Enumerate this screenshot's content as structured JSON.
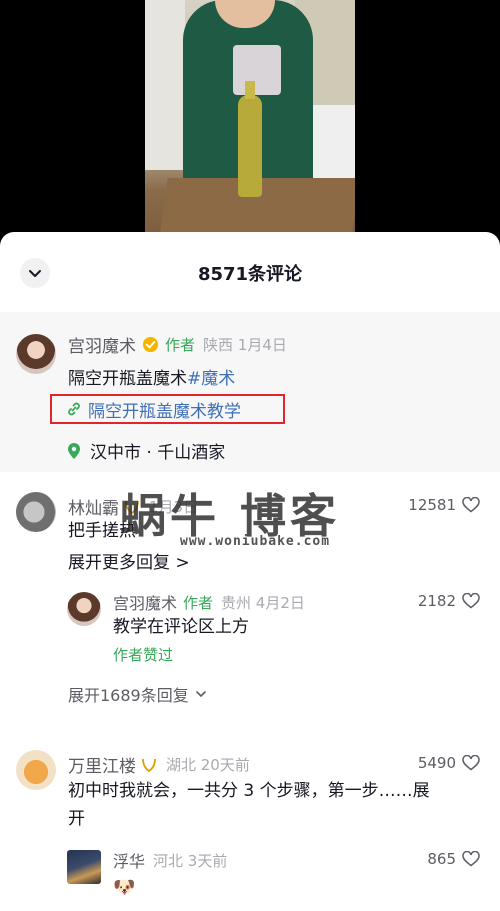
{
  "sheet": {
    "comment_count_title": "8571条评论"
  },
  "pinned_post": {
    "author_name": "宫羽魔术",
    "author_tag": "作者",
    "meta": "陕西 1月4日",
    "text": "隔空开瓶盖魔术",
    "hashtag": "#魔术",
    "link_text": "隔空开瓶盖魔术教学",
    "location": "汉中市 · 千山酒家"
  },
  "comments": [
    {
      "name": "林灿霸",
      "meta": "1月3日",
      "likes": "12581",
      "text": "把手搓热",
      "expand_more": "展开更多回复 >",
      "reply": {
        "name": "宫羽魔术",
        "tag": "作者",
        "meta": "贵州 4月2日",
        "likes": "2182",
        "text": "教学在评论区上方",
        "liked_note": "作者赞过"
      },
      "expand_replies": "展开1689条回复"
    },
    {
      "name": "万里江楼",
      "meta": "湖北 20天前",
      "likes": "5490",
      "text_line1": "初中时我就会，一共分 3 个步骤，第一步……展",
      "text_line2": "开",
      "reply": {
        "name": "浮华",
        "meta": "河北 3天前",
        "likes": "865",
        "emoji": "🐶"
      }
    }
  ],
  "watermark": {
    "big": "蜗牛 博客",
    "url": "www.woniubake.com"
  },
  "colors": {
    "accent_green": "#38a85b",
    "link_blue": "#3f6fb6",
    "highlight_box": "#e0262b"
  }
}
